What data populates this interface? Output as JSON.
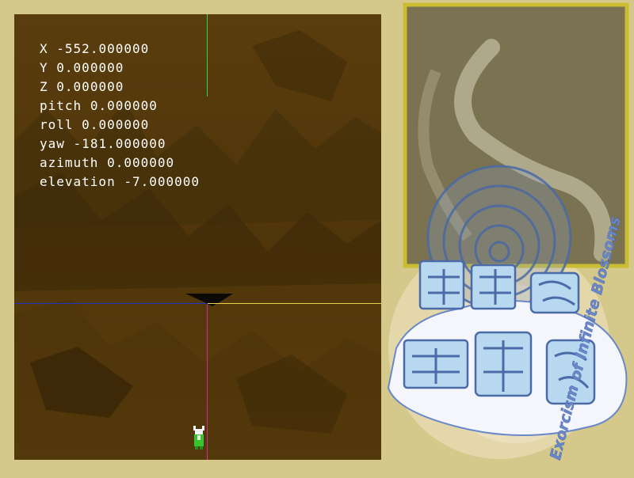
{
  "debug_readout": [
    {
      "label": "X",
      "value": "-552.000000"
    },
    {
      "label": "Y",
      "value": "0.000000"
    },
    {
      "label": "Z",
      "value": "0.000000"
    },
    {
      "label": "pitch",
      "value": "0.000000"
    },
    {
      "label": "roll",
      "value": "0.000000"
    },
    {
      "label": "yaw",
      "value": "-181.000000"
    },
    {
      "label": "azimuth",
      "value": "0.000000"
    },
    {
      "label": "elevation",
      "value": "-7.000000"
    }
  ],
  "title_art": {
    "logo_kanji": "朝霧ゆ",
    "subtitle": "Exorcism of Infinite Blossoms"
  },
  "colors": {
    "background": "#d4c98a",
    "terrain": "#5a3c0b",
    "axis_up": "#2fd64a",
    "axis_down": "#d02a9b",
    "axis_left": "#2233cc",
    "axis_right": "#e8d24a",
    "title_text": "#6a88c8"
  },
  "icons": {
    "player": "player-sprite-icon",
    "logo": "title-logo-icon"
  }
}
